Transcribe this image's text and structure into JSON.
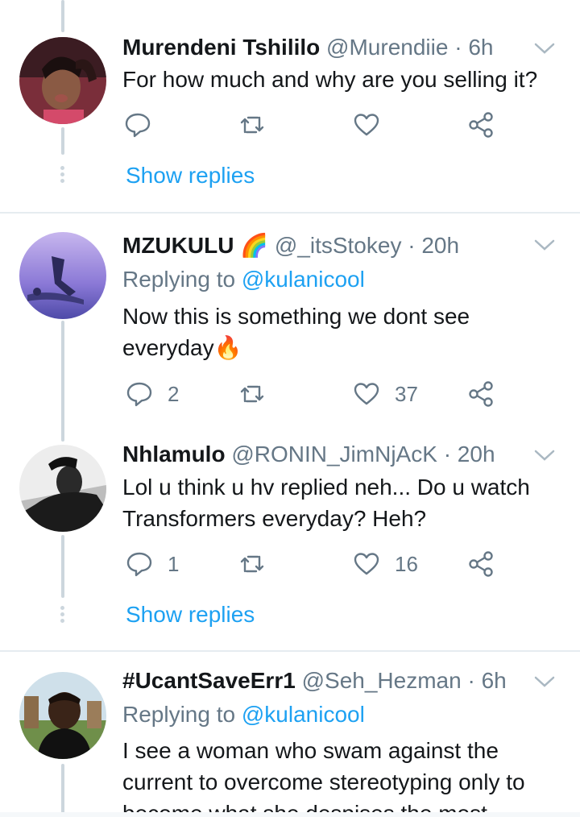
{
  "tweets": [
    {
      "name": "Murendeni Tshililo",
      "handle": "@Murendiie",
      "time": "6h",
      "replying_label": "",
      "replying_to": "",
      "text": "For how much and why are you selling it?",
      "replies": "",
      "likes": "",
      "show_replies": "Show replies"
    },
    {
      "name": "MZUKULU",
      "emoji": "🌈",
      "handle": "@_itsStokey",
      "time": "20h",
      "replying_label": "Replying to",
      "replying_to": "@kulanicool",
      "text": "Now this is something we dont see everyday",
      "text_emoji": "🔥",
      "replies": "2",
      "likes": "37",
      "show_replies": ""
    },
    {
      "name": "Nhlamulo",
      "handle": "@RONIN_JimNjAcK",
      "time": "20h",
      "replying_label": "",
      "replying_to": "",
      "text": "Lol u think u hv replied neh... Do u watch Transformers everyday? Heh?",
      "replies": "1",
      "likes": "16",
      "show_replies": "Show replies"
    },
    {
      "name": "#UcantSaveErr1",
      "handle": "@Seh_Hezman",
      "time": "6h",
      "replying_label": "Replying to",
      "replying_to": "@kulanicool",
      "text": "I see a woman who swam against the current to overcome stereotyping only to become what she despises the most",
      "replies": "",
      "likes": "",
      "show_replies": ""
    }
  ],
  "separator": "·",
  "colors": {
    "accent": "#1da1f2",
    "muted": "#657786",
    "text": "#14171a",
    "divider": "#e6ecf0"
  },
  "icons": [
    "reply-icon",
    "retweet-icon",
    "like-icon",
    "share-icon",
    "chevron-down-icon",
    "thread-dots-icon"
  ]
}
